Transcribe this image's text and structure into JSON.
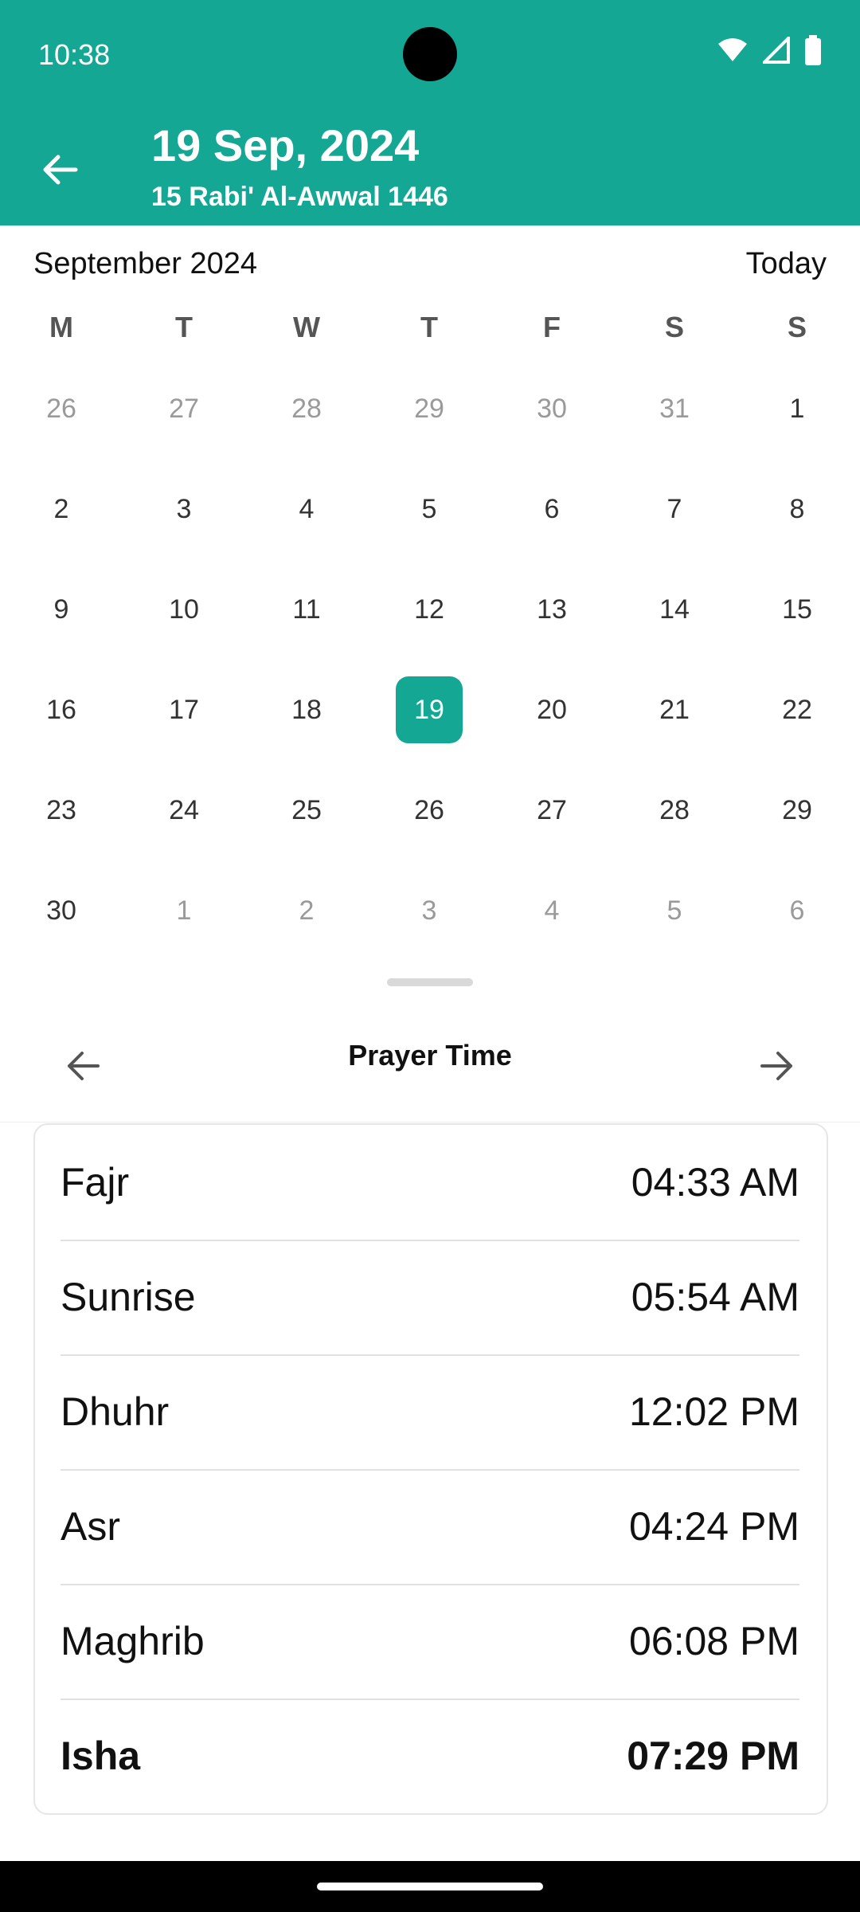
{
  "status_bar": {
    "time": "10:38"
  },
  "app_bar": {
    "title": "19 Sep, 2024",
    "subtitle": "15 Rabi' Al-Awwal 1446",
    "bg_color": "#14a794"
  },
  "calendar": {
    "month_label": "September 2024",
    "today_label": "Today",
    "weekdays": [
      "M",
      "T",
      "W",
      "T",
      "F",
      "S",
      "S"
    ],
    "weeks": [
      [
        {
          "d": "26",
          "m": true
        },
        {
          "d": "27",
          "m": true
        },
        {
          "d": "28",
          "m": true
        },
        {
          "d": "29",
          "m": true
        },
        {
          "d": "30",
          "m": true
        },
        {
          "d": "31",
          "m": true
        },
        {
          "d": "1",
          "m": false
        }
      ],
      [
        {
          "d": "2",
          "m": false
        },
        {
          "d": "3",
          "m": false
        },
        {
          "d": "4",
          "m": false
        },
        {
          "d": "5",
          "m": false
        },
        {
          "d": "6",
          "m": false
        },
        {
          "d": "7",
          "m": false
        },
        {
          "d": "8",
          "m": false
        }
      ],
      [
        {
          "d": "9",
          "m": false
        },
        {
          "d": "10",
          "m": false
        },
        {
          "d": "11",
          "m": false
        },
        {
          "d": "12",
          "m": false
        },
        {
          "d": "13",
          "m": false
        },
        {
          "d": "14",
          "m": false
        },
        {
          "d": "15",
          "m": false
        }
      ],
      [
        {
          "d": "16",
          "m": false
        },
        {
          "d": "17",
          "m": false
        },
        {
          "d": "18",
          "m": false
        },
        {
          "d": "19",
          "m": false,
          "sel": true
        },
        {
          "d": "20",
          "m": false
        },
        {
          "d": "21",
          "m": false
        },
        {
          "d": "22",
          "m": false
        }
      ],
      [
        {
          "d": "23",
          "m": false
        },
        {
          "d": "24",
          "m": false
        },
        {
          "d": "25",
          "m": false
        },
        {
          "d": "26",
          "m": false
        },
        {
          "d": "27",
          "m": false
        },
        {
          "d": "28",
          "m": false
        },
        {
          "d": "29",
          "m": false
        }
      ],
      [
        {
          "d": "30",
          "m": false
        },
        {
          "d": "1",
          "m": true
        },
        {
          "d": "2",
          "m": true
        },
        {
          "d": "3",
          "m": true
        },
        {
          "d": "4",
          "m": true
        },
        {
          "d": "5",
          "m": true
        },
        {
          "d": "6",
          "m": true
        }
      ]
    ],
    "selected_color": "#14a794"
  },
  "prayer": {
    "title": "Prayer Time",
    "times": [
      {
        "name": "Fajr",
        "time": "04:33 AM",
        "bold": false
      },
      {
        "name": "Sunrise",
        "time": "05:54 AM",
        "bold": false
      },
      {
        "name": "Dhuhr",
        "time": "12:02 PM",
        "bold": false
      },
      {
        "name": "Asr",
        "time": "04:24 PM",
        "bold": false
      },
      {
        "name": "Maghrib",
        "time": "06:08 PM",
        "bold": false
      },
      {
        "name": "Isha",
        "time": "07:29 PM",
        "bold": true
      }
    ]
  },
  "icons": {
    "back": "arrow-left-icon",
    "prev": "arrow-left-icon",
    "next": "arrow-right-icon",
    "wifi": "wifi-icon",
    "signal": "signal-icon",
    "battery": "battery-icon"
  }
}
